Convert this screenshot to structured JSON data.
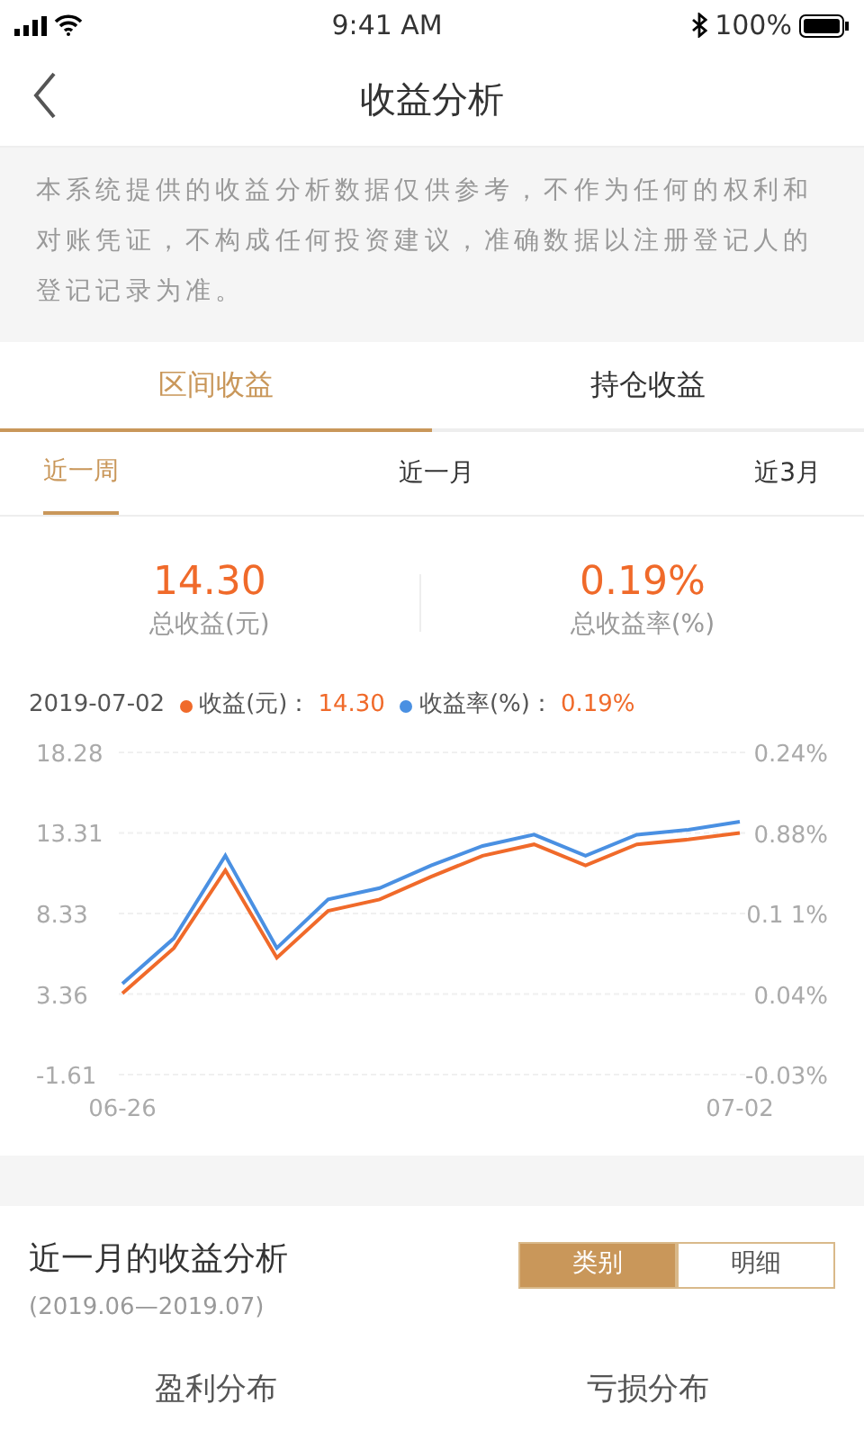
{
  "status_bar": {
    "time": "9:41 AM",
    "battery": "100%"
  },
  "nav": {
    "title": "收益分析"
  },
  "disclaimer": "本系统提供的收益分析数据仅供参考，不作为任何的权利和对账凭证，不构成任何投资建议，准确数据以注册登记人的登记记录为准。",
  "tabs": [
    {
      "label": "区间收益",
      "selected": true
    },
    {
      "label": "持仓收益",
      "selected": false
    }
  ],
  "periods": [
    {
      "label": "近一周",
      "selected": true
    },
    {
      "label": "近一月",
      "selected": false
    },
    {
      "label": "近3月",
      "selected": false
    }
  ],
  "summary": [
    {
      "value": "14.30",
      "label": "总收益(元)"
    },
    {
      "value": "0.19%",
      "label": "总收益率(%)"
    }
  ],
  "legend": {
    "date": "2019-07-02",
    "separator": "：",
    "values": [
      "14.30",
      "0.19%"
    ]
  },
  "chart": {
    "right_axis_labels": [
      "0.24%",
      "0.88%",
      "0.1 1%",
      "0.04%",
      "-0.03%"
    ],
    "chart_data": {
      "type": "line",
      "grid": true,
      "categories": [
        "06-26",
        null,
        null,
        null,
        null,
        null,
        null,
        null,
        null,
        null,
        null,
        null,
        "07-02"
      ],
      "ylim": [
        -1.61,
        18.28
      ],
      "yticks": [
        -1.61,
        3.36,
        8.33,
        13.31,
        18.28
      ],
      "series": [
        {
          "name": "收益(元)",
          "color": "#f06a2a",
          "values": [
            3.4,
            6.2,
            11.0,
            5.6,
            8.5,
            9.2,
            10.6,
            11.9,
            12.6,
            11.3,
            12.6,
            12.9,
            13.3
          ]
        },
        {
          "name": "收益率(%)",
          "color": "#4a90e2",
          "values": [
            4.0,
            6.8,
            11.9,
            6.2,
            9.2,
            9.9,
            11.3,
            12.5,
            13.2,
            11.9,
            13.2,
            13.5,
            14.0
          ]
        }
      ]
    }
  },
  "analysis": {
    "title": "近一月的收益分析",
    "range": "(2019.06—2019.07)",
    "toggle": [
      {
        "label": "类别",
        "selected": true
      },
      {
        "label": "明细",
        "selected": false
      }
    ],
    "columns": [
      "盈利分布",
      "亏损分布"
    ]
  }
}
